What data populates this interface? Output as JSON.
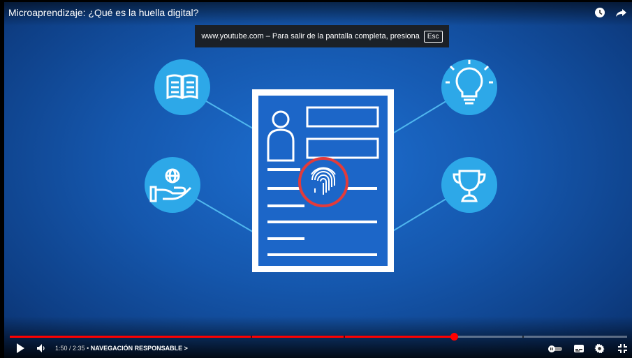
{
  "video": {
    "title": "Microaprendizaje: ¿Qué es la huella digital?"
  },
  "fullscreen_notice": {
    "text": "www.youtube.com – Para salir de la pantalla completa, presiona",
    "key": "Esc"
  },
  "controls": {
    "current_time": "1:50",
    "separator": " / ",
    "duration": "2:35",
    "chapter_bullet": " • ",
    "chapter": "NAVEGACIÓN RESPONSABLE",
    "chapter_arrow": " >",
    "progress": 0.72
  },
  "colors": {
    "accent": "#ff0000",
    "scene_blue": "#1a63c4",
    "icon_circle": "#2da8e8",
    "line": "#4fb6ee"
  },
  "icons": [
    "watch-later-icon",
    "share-icon",
    "play-icon",
    "volume-icon",
    "autoplay-toggle-icon",
    "subtitles-icon",
    "settings-icon",
    "exit-fullscreen-icon"
  ]
}
